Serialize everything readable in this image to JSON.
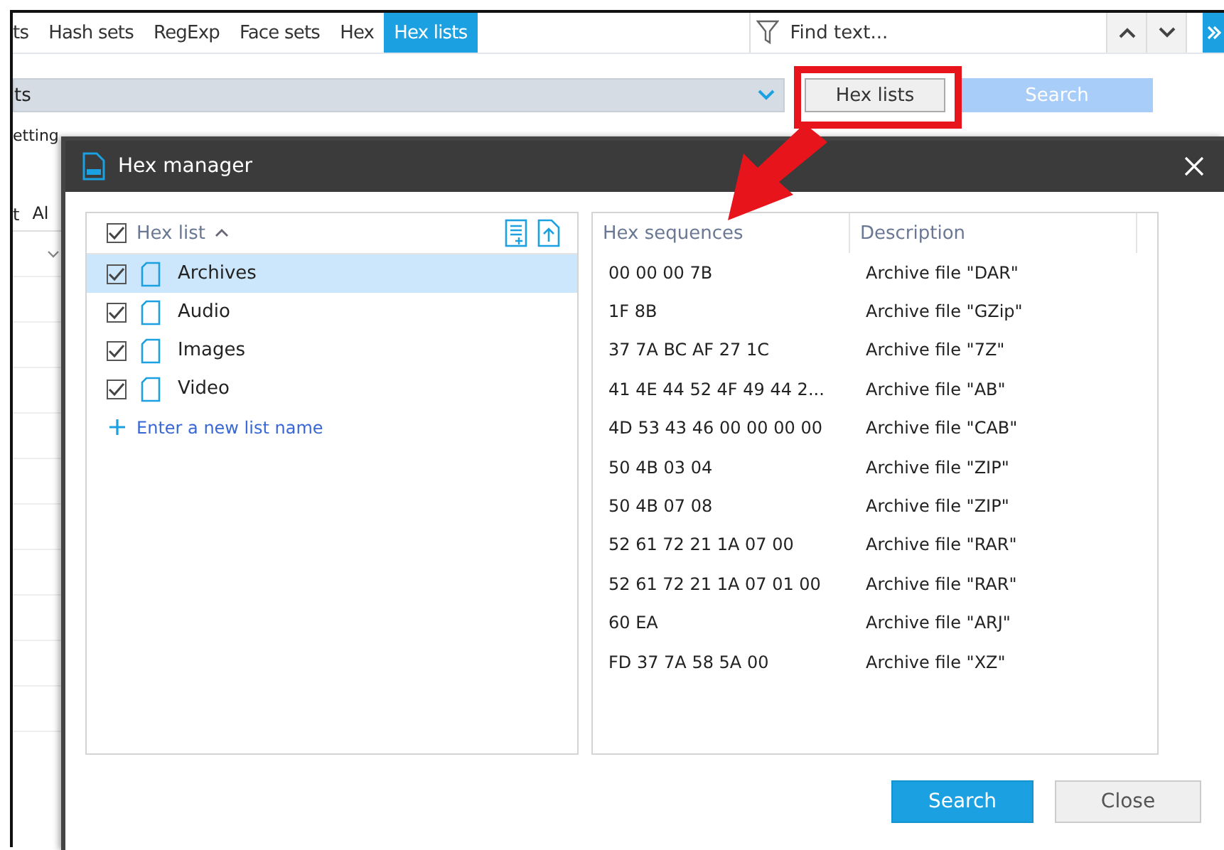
{
  "app": {
    "tabs": [
      {
        "label": "ts",
        "selected": false
      },
      {
        "label": "Hash sets",
        "selected": false
      },
      {
        "label": "RegExp",
        "selected": false
      },
      {
        "label": "Face sets",
        "selected": false
      },
      {
        "label": "Hex",
        "selected": false
      },
      {
        "label": "Hex lists",
        "selected": true
      }
    ],
    "find": {
      "placeholder": "Find text..."
    },
    "filter_value": "ts",
    "hex_lists_button": "Hex lists",
    "search_button": "Search",
    "side_texts": [
      "etting"
    ],
    "option_texts": [
      "t",
      "Al"
    ]
  },
  "dialog": {
    "title": "Hex manager",
    "list_header": {
      "label": "Hex list",
      "checked": true
    },
    "lists": [
      {
        "name": "Archives",
        "checked": true,
        "selected": true
      },
      {
        "name": "Audio",
        "checked": true,
        "selected": false
      },
      {
        "name": "Images",
        "checked": true,
        "selected": false
      },
      {
        "name": "Video",
        "checked": true,
        "selected": false
      }
    ],
    "new_list_link": "Enter a new list name",
    "columns": [
      "Hex sequences",
      "Description"
    ],
    "rows": [
      {
        "hex": "00 00 00 7B",
        "description": "Archive file \"DAR\""
      },
      {
        "hex": "1F 8B",
        "description": "Archive file \"GZip\""
      },
      {
        "hex": "37 7A BC AF 27 1C",
        "description": "Archive file \"7Z\""
      },
      {
        "hex": "41 4E 44 52 4F 49 44 2...",
        "description": "Archive file \"AB\""
      },
      {
        "hex": "4D 53 43 46 00 00 00 00",
        "description": "Archive file \"CAB\""
      },
      {
        "hex": "50 4B 03 04",
        "description": "Archive file \"ZIP\""
      },
      {
        "hex": "50 4B 07 08",
        "description": "Archive file \"ZIP\""
      },
      {
        "hex": "52 61 72 21 1A 07 00",
        "description": "Archive file \"RAR\""
      },
      {
        "hex": "52 61 72 21 1A 07 01 00",
        "description": "Archive file \"RAR\""
      },
      {
        "hex": "60 EA",
        "description": "Archive file \"ARJ\""
      },
      {
        "hex": "FD 37 7A 58 5A 00",
        "description": "Archive file \"XZ\""
      }
    ],
    "buttons": [
      {
        "label": "Search",
        "kind": "primary"
      },
      {
        "label": "Close",
        "kind": "secondary"
      }
    ]
  }
}
